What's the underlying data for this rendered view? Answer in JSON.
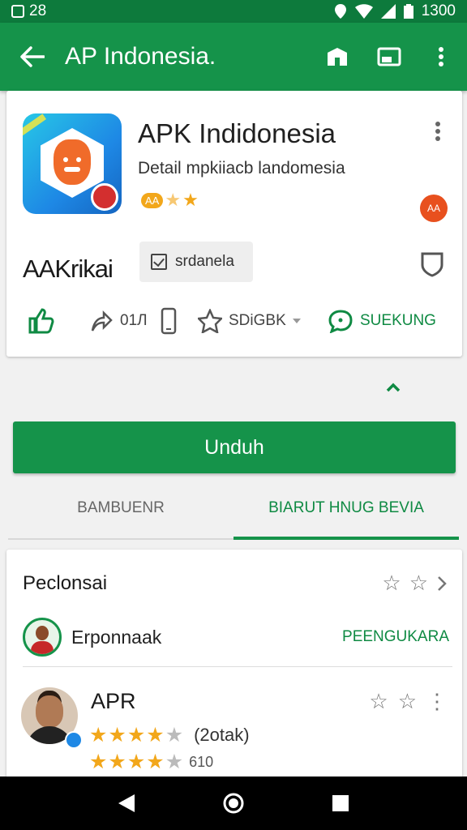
{
  "status_bar": {
    "left_text": "28",
    "time": "1300"
  },
  "appbar": {
    "title": "AP Indonesia."
  },
  "app": {
    "name": "APK Indidonesia",
    "subtitle": "Detail mpkiiacb landomesia",
    "rating_pill": "AA",
    "stars": [
      "★",
      "★"
    ],
    "red_badge": "AA",
    "developer": "AAKrikai",
    "chip_label": "srdanela",
    "actions": {
      "share_count": "01Л",
      "wishlist_label": "SDiGBK",
      "chat_label": "SUEKUNG"
    }
  },
  "install_button": {
    "label": "Unduh"
  },
  "tabs": [
    {
      "label": "BAMBUENR",
      "active": false
    },
    {
      "label": "BIARUT HNUG BEVIA",
      "active": true
    }
  ],
  "reviews": {
    "section_title": "Peclonsai",
    "header_stars": [
      "☆",
      "☆"
    ],
    "developer_row": {
      "name": "Erponnaak",
      "link": "PEENGUKARA"
    },
    "review": {
      "user": "APR",
      "stars_row1": [
        "★",
        "★",
        "★",
        "★",
        "★"
      ],
      "count_label": "(2otak)",
      "stars_row2": [
        "★",
        "★",
        "★",
        "★",
        "★"
      ],
      "count2_label": "610",
      "icon_stars": [
        "☆",
        "☆"
      ],
      "more": "⋮"
    }
  },
  "colors": {
    "primary": "#15934a",
    "primary_dark": "#0d7a3c",
    "accent_text": "#0f8a43",
    "star": "#f2a71b"
  }
}
